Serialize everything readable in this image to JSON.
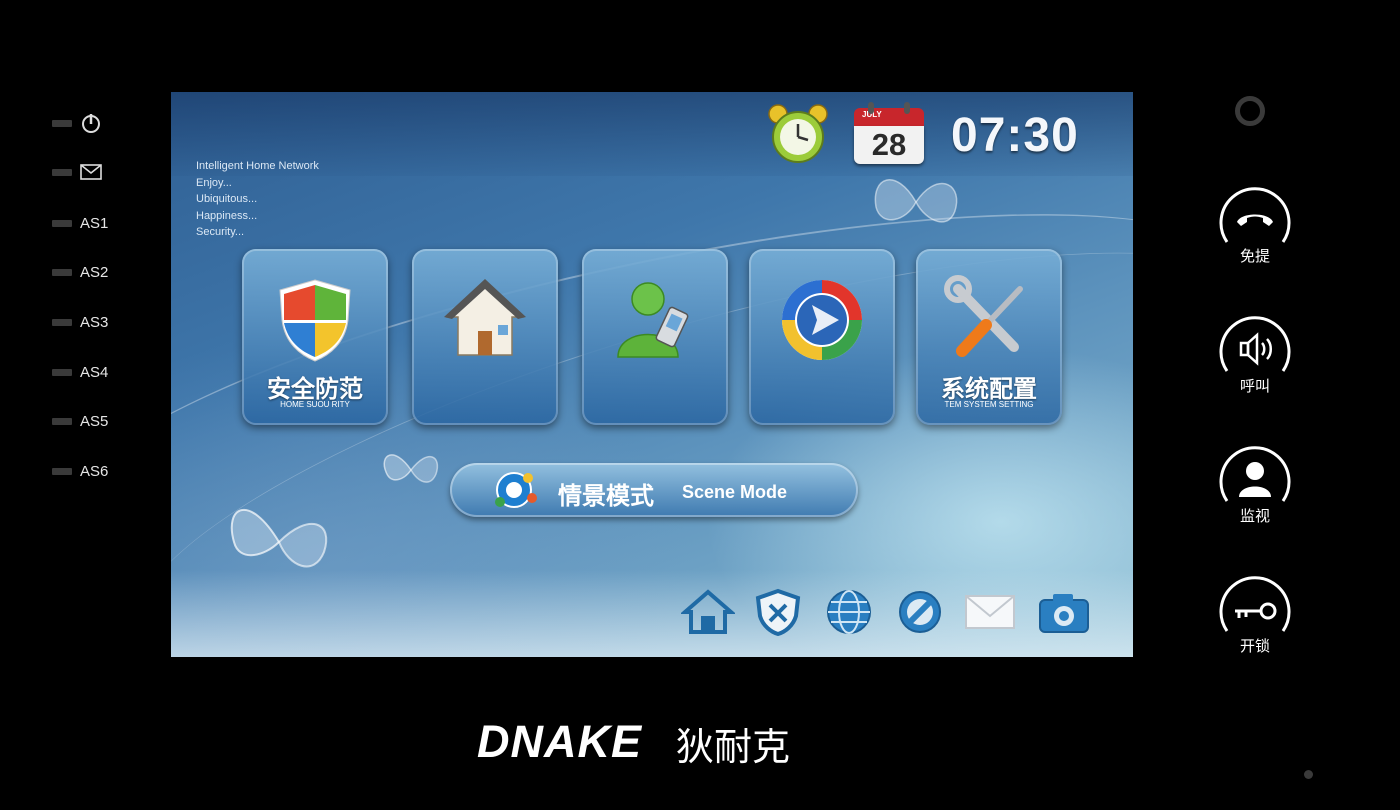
{
  "left_indicators": [
    {
      "type": "icon",
      "icon": "power-icon"
    },
    {
      "type": "icon",
      "icon": "mail-icon"
    },
    {
      "type": "text",
      "label": "AS1"
    },
    {
      "type": "text",
      "label": "AS2"
    },
    {
      "type": "text",
      "label": "AS3"
    },
    {
      "type": "text",
      "label": "AS4"
    },
    {
      "type": "text",
      "label": "AS5"
    },
    {
      "type": "text",
      "label": "AS6"
    }
  ],
  "screen": {
    "tagline": [
      "Intelligent Home Network",
      "Enjoy...",
      "Ubiquitous...",
      "Happiness...",
      "Security..."
    ],
    "calendar": {
      "month": "JULY",
      "day": "28"
    },
    "time": "07:30",
    "tiles": [
      {
        "title": "安全防范",
        "subtitle": "HOME SUOU RITY",
        "icon": "shield-icon"
      },
      {
        "title": "",
        "subtitle": "",
        "icon": "house-icon"
      },
      {
        "title": "",
        "subtitle": "",
        "icon": "user-phone-icon"
      },
      {
        "title": "",
        "subtitle": "",
        "icon": "play-icon"
      },
      {
        "title": "系统配置",
        "subtitle": "TEM  SYSTEM  SETTING",
        "icon": "tools-icon"
      }
    ],
    "scene": {
      "cn": "情景模式",
      "en": "Scene Mode"
    },
    "bottom_icons": [
      "home-icon",
      "security-x-icon",
      "globe-icon",
      "forbidden-icon",
      "envelope-icon",
      "camera-icon"
    ]
  },
  "right_buttons": [
    {
      "label": "免提",
      "icon": "handset-icon"
    },
    {
      "label": "呼叫",
      "icon": "speaker-icon"
    },
    {
      "label": "监视",
      "icon": "person-icon"
    },
    {
      "label": "开锁",
      "icon": "key-icon"
    }
  ],
  "brand": {
    "name": "DNAKE",
    "cn": "狄耐克"
  },
  "colors": {
    "screen_blue": "#3f77ab",
    "tile_blue": "#2f6fa8",
    "calendar_red": "#c8262c"
  }
}
